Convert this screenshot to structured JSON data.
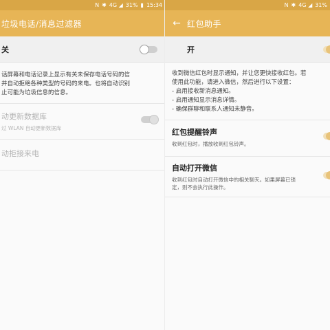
{
  "left": {
    "status": {
      "nfc": "N",
      "signal": "4G ◢",
      "battery": "31%",
      "time": "15:34"
    },
    "title": "垃圾电话/消息过滤器",
    "master_label": "关",
    "description": [
      "话屏幕和电话记录上显示有关未保存电话号码的信",
      "并自动拒绝各种类型的号码的来电。也将自动识别",
      "止可能为垃圾信息的信息。"
    ],
    "auto_update": {
      "title": "动更新数据库",
      "subtitle": "过 WLAN 自动更新数据库"
    },
    "auto_reject": {
      "title": "动拒接来电"
    }
  },
  "right": {
    "status": {
      "nfc": "N",
      "signal": "4G ◢",
      "battery": "31%"
    },
    "back_glyph": "←",
    "title": "红包助手",
    "master_label": "开",
    "description": [
      "收到微信红包时显示通知，并让您更快接收红包。若",
      "使用此功能，请进入微信，然后进行以下设置：",
      "- 启用接收新消息通知。",
      "- 启用通知显示消息详情。",
      "- 确保群聊和联系人通知未静音。"
    ],
    "ringtone": {
      "title": "红包提醒铃声",
      "subtitle": "收到红包时，播放收到红包铃声。"
    },
    "auto_open": {
      "title": "自动打开微信",
      "subtitle_1": "收到红包时自动打开微信中的相关聊天。如果屏幕已锁",
      "subtitle_2": "定，则不会执行此操作。"
    }
  }
}
